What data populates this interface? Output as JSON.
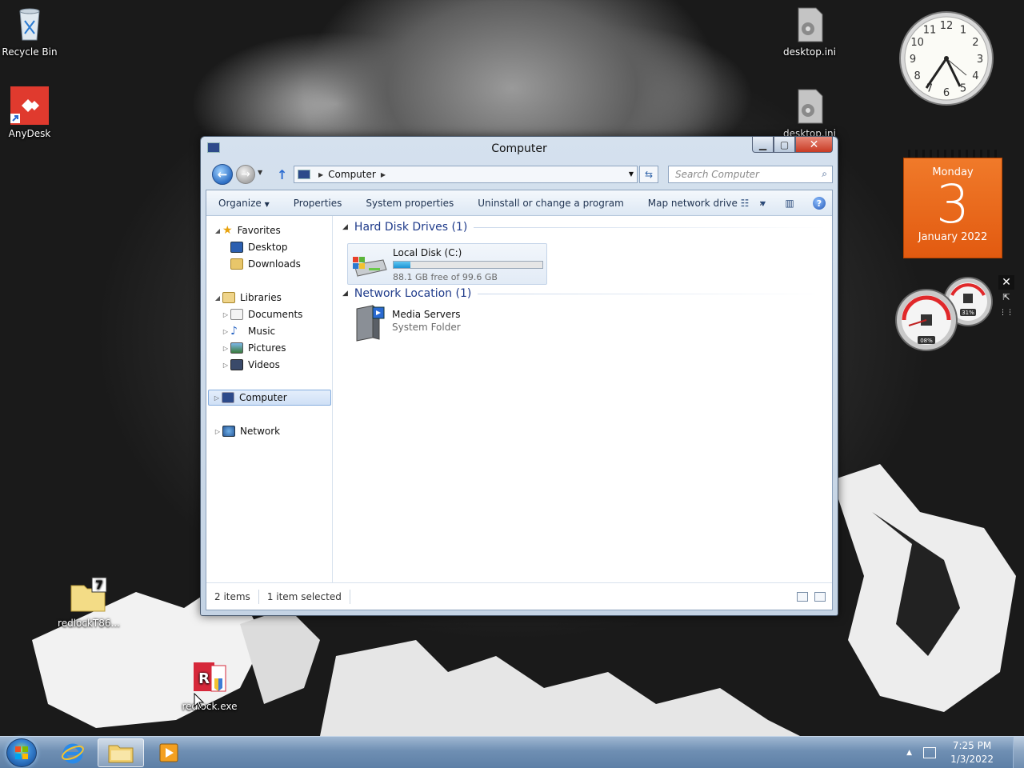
{
  "desktop": {
    "icons": [
      {
        "label": "Recycle Bin"
      },
      {
        "label": "AnyDesk"
      },
      {
        "label": "desktop.ini"
      },
      {
        "label": "desktop.ini"
      },
      {
        "label": "redlockT86..."
      },
      {
        "label": "redlock.exe"
      }
    ]
  },
  "gadgets": {
    "clock": {
      "numbers": [
        "12",
        "1",
        "2",
        "3",
        "4",
        "5",
        "6",
        "7",
        "8",
        "9",
        "10",
        "11"
      ],
      "time": "7:25"
    },
    "calendar": {
      "day_name": "Monday",
      "day_number": "3",
      "month_year": "January 2022"
    },
    "meter": {
      "cpu": "08%",
      "memory": "31%"
    }
  },
  "window": {
    "title": "Computer",
    "address_crumb": "Computer",
    "search_placeholder": "Search Computer",
    "toolbar": {
      "organize": "Organize",
      "properties": "Properties",
      "system_properties": "System properties",
      "uninstall": "Uninstall or change a program",
      "map_drive": "Map network drive",
      "more": "»"
    },
    "nav": {
      "favorites": "Favorites",
      "desktop": "Desktop",
      "downloads": "Downloads",
      "libraries": "Libraries",
      "documents": "Documents",
      "music": "Music",
      "pictures": "Pictures",
      "videos": "Videos",
      "computer": "Computer",
      "network": "Network"
    },
    "groups": {
      "hdd_header": "Hard Disk Drives (1)",
      "net_header": "Network Location (1)"
    },
    "drive": {
      "name": "Local Disk (C:)",
      "free_text": "88.1 GB free of 99.6 GB",
      "used_fraction": 0.115
    },
    "media": {
      "name": "Media Servers",
      "type": "System Folder"
    },
    "status": {
      "items": "2 items",
      "selected": "1 item selected"
    }
  },
  "taskbar": {
    "time": "7:25 PM",
    "date": "1/3/2022"
  },
  "colors": {
    "calendar": "#e8661c",
    "taskbar": "#6f8fb3",
    "group_header": "#1e3a8a"
  }
}
